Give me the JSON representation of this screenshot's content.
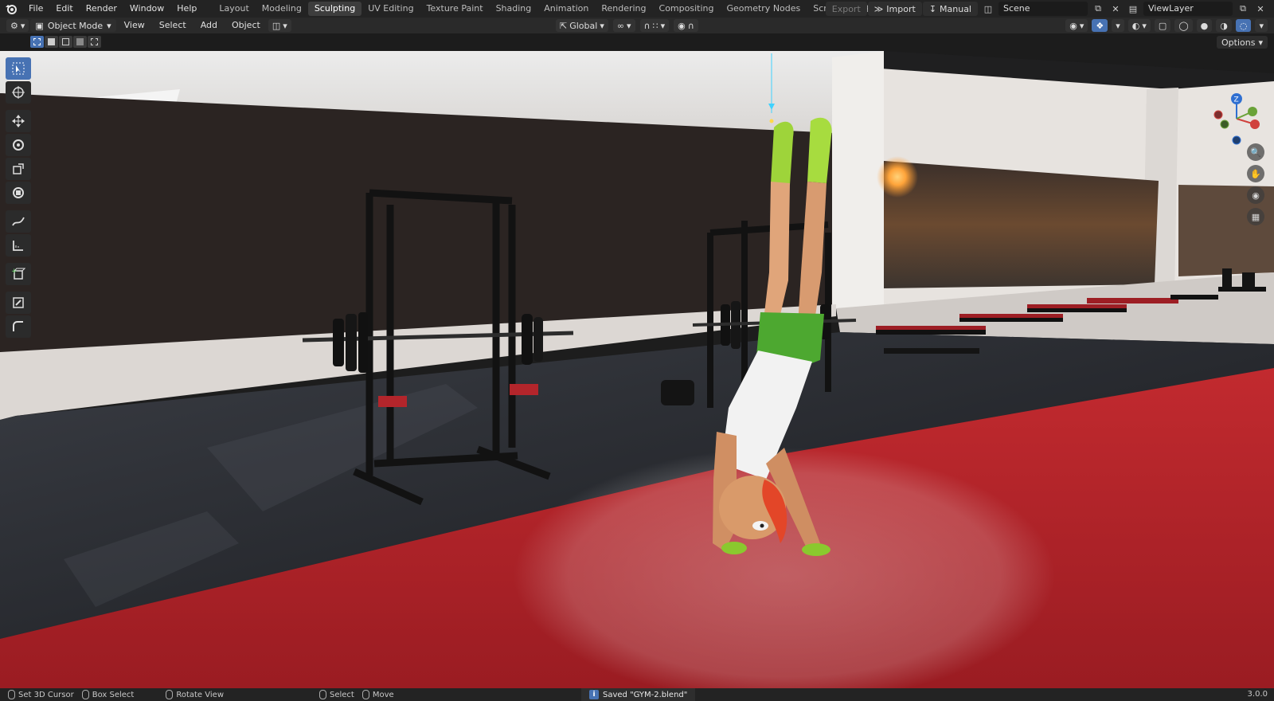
{
  "menu": {
    "items": [
      "File",
      "Edit",
      "Render",
      "Window",
      "Help"
    ]
  },
  "workspaces": {
    "tabs": [
      "Layout",
      "Modeling",
      "Sculpting",
      "UV Editing",
      "Texture Paint",
      "Shading",
      "Animation",
      "Rendering",
      "Compositing",
      "Geometry Nodes",
      "Scripting"
    ],
    "active": "Sculpting",
    "add_label": "+"
  },
  "topright": {
    "export_label": "Export",
    "import_label": "Import",
    "manual_label": "Manual",
    "scene_name": "Scene",
    "view_layer": "ViewLayer"
  },
  "header": {
    "mode_label": "Object Mode",
    "menus": [
      "View",
      "Select",
      "Add",
      "Object"
    ],
    "transform_orientation": "Global"
  },
  "subheader": {
    "options_label": "Options"
  },
  "toolbar": {
    "tools": [
      "select-box-icon",
      "cursor-icon",
      "move-icon",
      "rotate-icon",
      "scale-icon",
      "transform-icon",
      "annotate-icon",
      "measure-icon",
      "add-cube-icon",
      "extrude-icon",
      "bevel-icon"
    ]
  },
  "gizmo": {
    "axis_z": "Z"
  },
  "statusbar": {
    "set_cursor": "Set 3D Cursor",
    "box_select": "Box Select",
    "rotate_view": "Rotate View",
    "select": "Select",
    "move": "Move",
    "message": "Saved \"GYM-2.blend\"",
    "version": "3.0.0"
  },
  "colors": {
    "accent": "#4772b3",
    "mat_red": "#b8242a",
    "floor": "#2a2c30",
    "wall": "#d9d6d3"
  }
}
